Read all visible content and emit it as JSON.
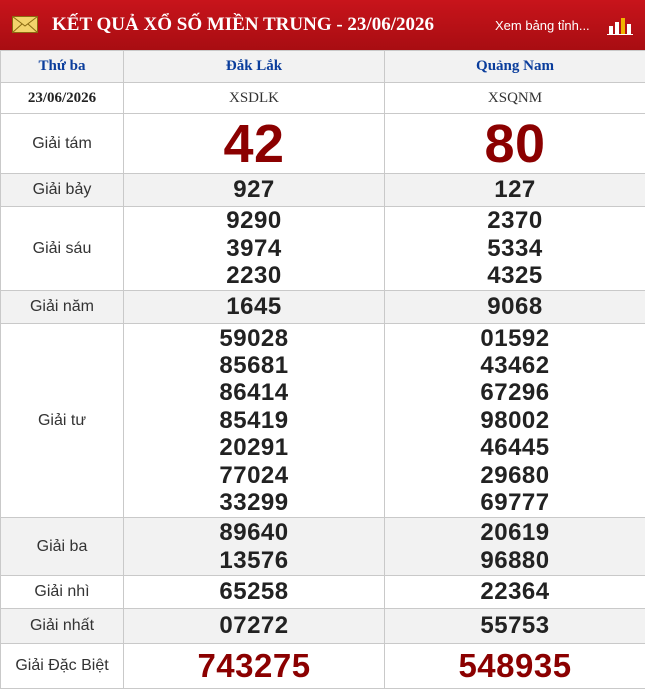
{
  "header": {
    "title": "KẾT QUẢ XỔ SỐ MIỀN TRUNG - 23/06/2026",
    "link_label": "Xem bảng tỉnh...",
    "bg_color": "#b5111a",
    "mail_icon": "envelope-icon",
    "chart_icon": "bar-chart-icon"
  },
  "table": {
    "day": "Thứ ba",
    "date": "23/06/2026",
    "provinces": [
      {
        "name": "Đắk Lắk",
        "code": "XSDLK"
      },
      {
        "name": "Quảng Nam",
        "code": "XSQNM"
      }
    ],
    "prizes": [
      {
        "label": "Giải tám",
        "style": "big",
        "values": [
          [
            "42"
          ],
          [
            "80"
          ]
        ]
      },
      {
        "label": "Giải bảy",
        "values": [
          [
            "927"
          ],
          [
            "127"
          ]
        ]
      },
      {
        "label": "Giải sáu",
        "values": [
          [
            "9290",
            "3974",
            "2230"
          ],
          [
            "2370",
            "5334",
            "4325"
          ]
        ]
      },
      {
        "label": "Giải năm",
        "values": [
          [
            "1645"
          ],
          [
            "9068"
          ]
        ]
      },
      {
        "label": "Giải tư",
        "values": [
          [
            "59028",
            "85681",
            "86414",
            "85419",
            "20291",
            "77024",
            "33299"
          ],
          [
            "01592",
            "43462",
            "67296",
            "98002",
            "46445",
            "29680",
            "69777"
          ]
        ]
      },
      {
        "label": "Giải ba",
        "values": [
          [
            "89640",
            "13576"
          ],
          [
            "20619",
            "96880"
          ]
        ]
      },
      {
        "label": "Giải nhì",
        "values": [
          [
            "65258"
          ],
          [
            "22364"
          ]
        ]
      },
      {
        "label": "Giải nhất",
        "values": [
          [
            "07272"
          ],
          [
            "55753"
          ]
        ]
      },
      {
        "label": "Giải Đặc Biệt",
        "style": "special",
        "values": [
          [
            "743275"
          ],
          [
            "548935"
          ]
        ]
      }
    ]
  },
  "colors": {
    "province_text": "#0a3d9c",
    "jackpot_text": "#8b0000",
    "alt_row_bg": "#f2f2f2"
  }
}
